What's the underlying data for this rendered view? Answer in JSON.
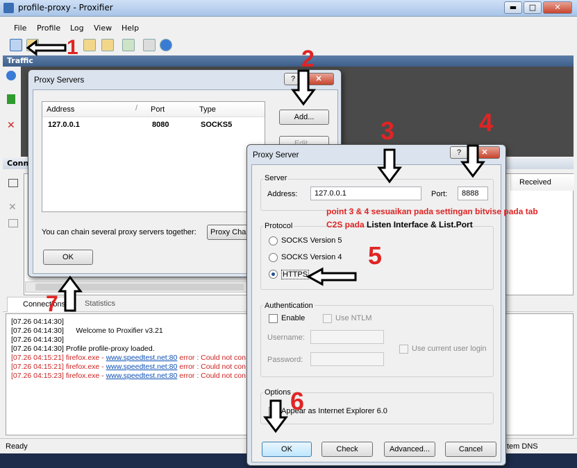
{
  "window": {
    "title": "profile-proxy - Proxifier",
    "minimize": "▬",
    "maximize": "□",
    "close": "✕"
  },
  "menu": [
    "File",
    "Profile",
    "Log",
    "View",
    "Help"
  ],
  "panels": {
    "traffic": "Traffic",
    "connections": "Connections",
    "received_col": "Received",
    "tab_connections": "Connections",
    "tab_statistics": "Statistics",
    "system_dns": "tem DNS"
  },
  "log": [
    {
      "text": "[07.26 04:14:30]",
      "err": false
    },
    {
      "text": "[07.26 04:14:30]      Welcome to Proxifier v3.21",
      "err": false
    },
    {
      "text": "[07.26 04:14:30]",
      "err": false
    },
    {
      "text": "[07.26 04:14:30] Profile profile-proxy loaded.",
      "err": false
    },
    {
      "prefix": "[07.26 04:15:21] firefox.exe - ",
      "link": "www.speedtest.net:80",
      "suffix": " error : Could not con",
      "err": true
    },
    {
      "prefix": "[07.26 04:15:21] firefox.exe - ",
      "link": "www.speedtest.net:80",
      "suffix": " error : Could not con",
      "err": true
    },
    {
      "prefix": "[07.26 04:15:23] firefox.exe - ",
      "link": "www.speedtest.net:80",
      "suffix": " error : Could not con",
      "err": true
    }
  ],
  "status": {
    "ready": "Ready"
  },
  "proxy_servers": {
    "title": "Proxy Servers",
    "help": "?",
    "close": "✕",
    "columns": [
      "Address",
      "Port",
      "Type"
    ],
    "rows": [
      {
        "address": "127.0.0.1",
        "port": "8080",
        "type": "SOCKS5"
      }
    ],
    "add": "Add...",
    "edit": "Edit...",
    "chain_text": "You can chain several proxy servers together:",
    "chain_btn": "Proxy Chai",
    "ok": "OK"
  },
  "proxy_server": {
    "title": "Proxy Server",
    "help": "?",
    "close": "✕",
    "server_group": "Server",
    "address_label": "Address:",
    "address_value": "127.0.0.1",
    "port_label": "Port:",
    "port_value": "8888",
    "protocol_group": "Protocol",
    "socks5": "SOCKS Version 5",
    "socks4": "SOCKS Version 4",
    "https": "HTTPS",
    "protocol_selected": "HTTPS",
    "auth_group": "Authentication",
    "enable": "Enable",
    "use_ntlm": "Use NTLM",
    "username": "Username:",
    "password": "Password:",
    "use_current_user": "Use current user login",
    "options_group": "Options",
    "ie_option": "Appear as Internet Explorer 6.0",
    "ok": "OK",
    "check": "Check",
    "advanced": "Advanced...",
    "cancel": "Cancel"
  },
  "annotations": {
    "n1": "1",
    "n2": "2",
    "n3": "3",
    "n4": "4",
    "n5": "5",
    "n6": "6",
    "n7": "7",
    "note_line1": "point 3 & 4 sesuaikan pada settingan bitvise pada tab",
    "note_line2_red": "C2S pada ",
    "note_line2_black": "Listen Interface & List.Port",
    "color": "#e02424"
  }
}
